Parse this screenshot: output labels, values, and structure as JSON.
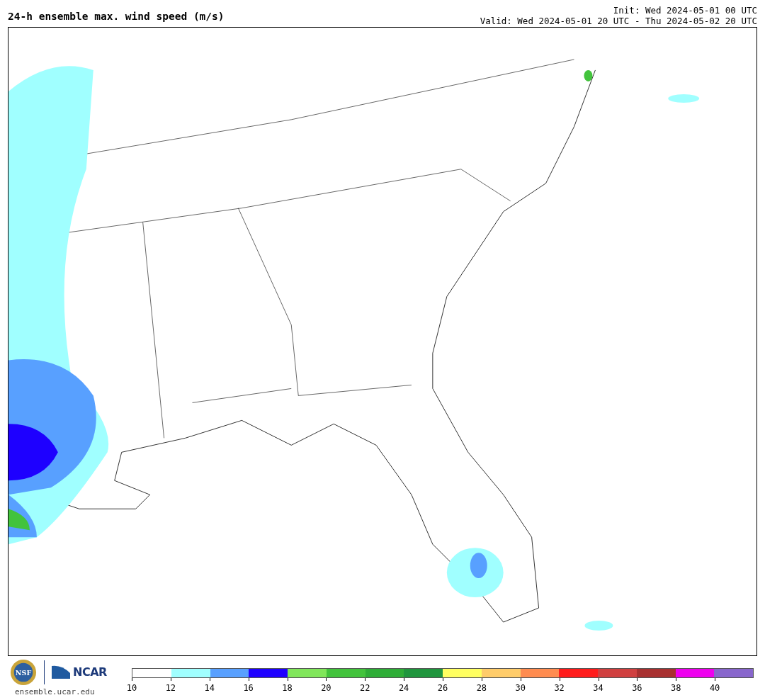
{
  "header": {
    "title": "24-h ensemble max. wind speed (m/s)",
    "init": "Init: Wed 2024-05-01 00 UTC",
    "valid": "Valid: Wed 2024-05-01 20 UTC - Thu 2024-05-02 20 UTC"
  },
  "footer": {
    "nsf_logo": "NSF",
    "ncar_logo": "NCAR",
    "site": "ensemble.ucar.edu"
  },
  "colorbar": {
    "bins": [
      {
        "label": "10",
        "color": "#ffffff"
      },
      {
        "label": "12",
        "color": "#a0ffff"
      },
      {
        "label": "14",
        "color": "#58a0ff"
      },
      {
        "label": "16",
        "color": "#1e00ff"
      },
      {
        "label": "18",
        "color": "#80e65a"
      },
      {
        "label": "20",
        "color": "#42c33c"
      },
      {
        "label": "22",
        "color": "#2ead37"
      },
      {
        "label": "24",
        "color": "#20963e"
      },
      {
        "label": "26",
        "color": "#ffff60"
      },
      {
        "label": "28",
        "color": "#ffcc6a"
      },
      {
        "label": "30",
        "color": "#ff8c50"
      },
      {
        "label": "32",
        "color": "#ff1c1c"
      },
      {
        "label": "34",
        "color": "#d04040"
      },
      {
        "label": "36",
        "color": "#a83030"
      },
      {
        "label": "38",
        "color": "#ee00ee"
      },
      {
        "label": "40",
        "color": "#8866cc"
      }
    ]
  }
}
